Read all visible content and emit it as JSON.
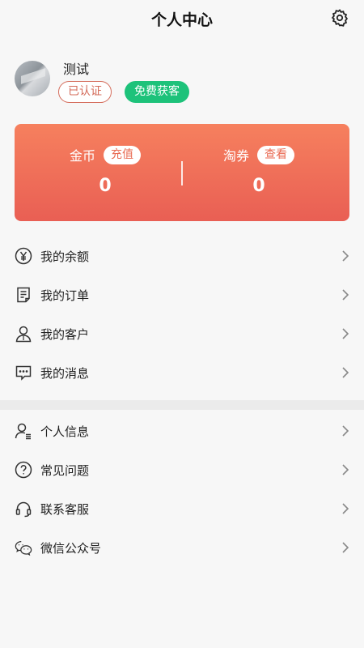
{
  "header": {
    "title": "个人中心",
    "settings_icon": "gear-icon"
  },
  "profile": {
    "name": "测试",
    "badges": {
      "verified": "已认证",
      "free_customers": "免费获客"
    },
    "avatar_icon": "avatar"
  },
  "wallet": {
    "coins": {
      "label": "金币",
      "action": "充值",
      "value": "0"
    },
    "coupons": {
      "label": "淘券",
      "action": "查看",
      "value": "0"
    }
  },
  "menu_primary": [
    {
      "label": "我的余额",
      "icon": "yen-icon"
    },
    {
      "label": "我的订单",
      "icon": "order-list-icon"
    },
    {
      "label": "我的客户",
      "icon": "customer-icon"
    },
    {
      "label": "我的消息",
      "icon": "message-icon"
    }
  ],
  "menu_secondary": [
    {
      "label": "个人信息",
      "icon": "profile-info-icon"
    },
    {
      "label": "常见问题",
      "icon": "question-icon"
    },
    {
      "label": "联系客服",
      "icon": "headset-icon"
    },
    {
      "label": "微信公众号",
      "icon": "wechat-icon"
    }
  ],
  "colors": {
    "wallet_top": "#f6805e",
    "wallet_bottom": "#e95f54",
    "verified": "#d46b5a",
    "free_badge": "#1dc27a"
  }
}
